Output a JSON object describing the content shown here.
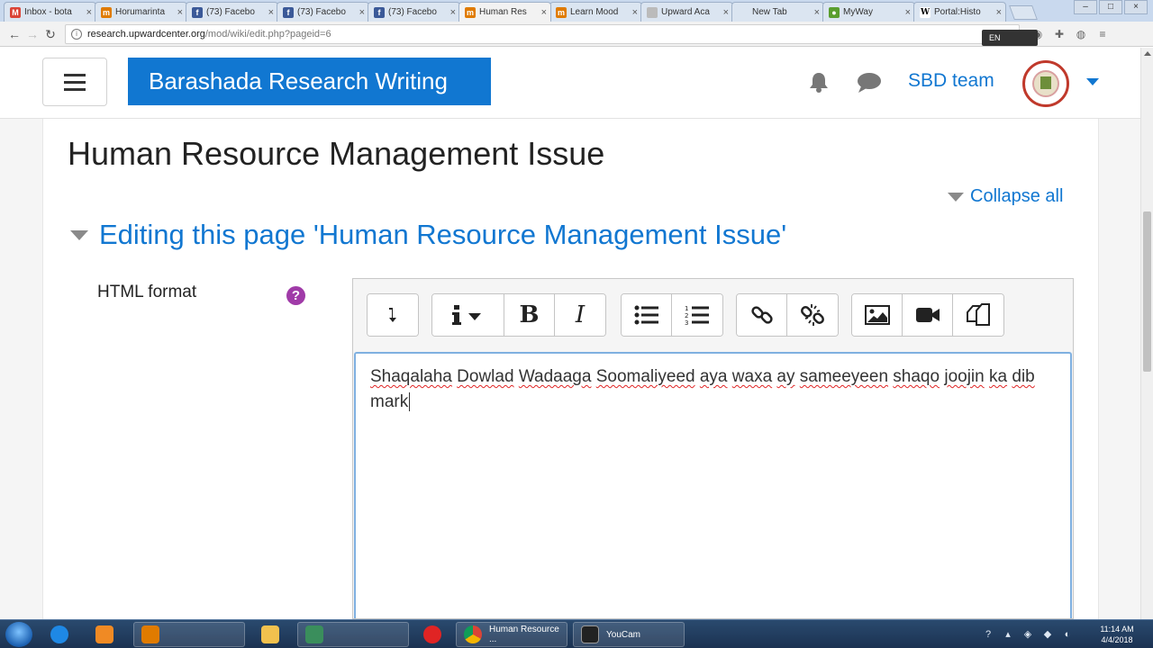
{
  "browser": {
    "tabs": [
      {
        "label": "Inbox - bota",
        "favicon_color": "#db4437",
        "glyph": "M"
      },
      {
        "label": "Horumarinta",
        "favicon_color": "#e07b00",
        "glyph": "m"
      },
      {
        "label": "(73) Facebo",
        "favicon_color": "#3b5998",
        "glyph": "f"
      },
      {
        "label": "(73) Facebo",
        "favicon_color": "#3b5998",
        "glyph": "f"
      },
      {
        "label": "(73) Facebo",
        "favicon_color": "#3b5998",
        "glyph": "f"
      },
      {
        "label": "Human Res",
        "favicon_color": "#e07b00",
        "glyph": "m"
      },
      {
        "label": "Learn Mood",
        "favicon_color": "#e07b00",
        "glyph": "m"
      },
      {
        "label": "Upward Aca",
        "favicon_color": "#bbbbbb",
        "glyph": ""
      },
      {
        "label": "New Tab",
        "favicon_color": "",
        "glyph": ""
      },
      {
        "label": "MyWay",
        "favicon_color": "#5a9e2f",
        "glyph": "●"
      },
      {
        "label": "Portal:Histo",
        "favicon_color": "#ffffff",
        "glyph": "W"
      }
    ],
    "active_tab": 5,
    "tab_close_glyph": "×",
    "url_host": "research.upwardcenter.org",
    "url_path": "/mod/wiki/edit.php?pageid=6",
    "lang_badge": "EN"
  },
  "navbar": {
    "brand": "Barashada Research Writing",
    "user_name": "SBD team"
  },
  "page": {
    "title": "Human Resource Management Issue",
    "collapse_all": "Collapse all",
    "section_heading": "Editing this page 'Human Resource Management Issue'",
    "field_label": "HTML format",
    "help_glyph": "?"
  },
  "editor": {
    "toolbar": [
      {
        "name": "collapse-toolbar-button",
        "icon": "arrow-down-icon"
      },
      {
        "name": "paragraph-styles-button",
        "icon": "info-icon"
      },
      {
        "name": "bold-button",
        "icon": "bold-icon",
        "glyph": "B"
      },
      {
        "name": "italic-button",
        "icon": "italic-icon",
        "glyph": "I"
      },
      {
        "name": "unordered-list-button",
        "icon": "bullet-list-icon"
      },
      {
        "name": "ordered-list-button",
        "icon": "numbered-list-icon"
      },
      {
        "name": "link-button",
        "icon": "link-icon"
      },
      {
        "name": "unlink-button",
        "icon": "unlink-icon"
      },
      {
        "name": "insert-image-button",
        "icon": "image-icon"
      },
      {
        "name": "insert-media-button",
        "icon": "video-camera-icon"
      },
      {
        "name": "manage-files-button",
        "icon": "copy-files-icon"
      }
    ],
    "content_words": [
      "Shaqalaha",
      "Dowlad",
      "Wadaaga",
      "Soomaliyeed",
      "aya",
      "waxa",
      "ay",
      "sameeyeen",
      "shaqo",
      "joojin",
      "ka",
      "dib",
      "mark"
    ],
    "misspelled": [
      true,
      true,
      true,
      true,
      true,
      true,
      true,
      true,
      true,
      true,
      true,
      true,
      false
    ]
  },
  "taskbar": {
    "apps": [
      {
        "label": "Human Resource ..."
      },
      {
        "label": "YouCam"
      }
    ],
    "clock_time": "11:14 AM",
    "clock_date": "4/4/2018"
  },
  "colors": {
    "accent": "#1177d1",
    "help": "#a03ba8"
  }
}
